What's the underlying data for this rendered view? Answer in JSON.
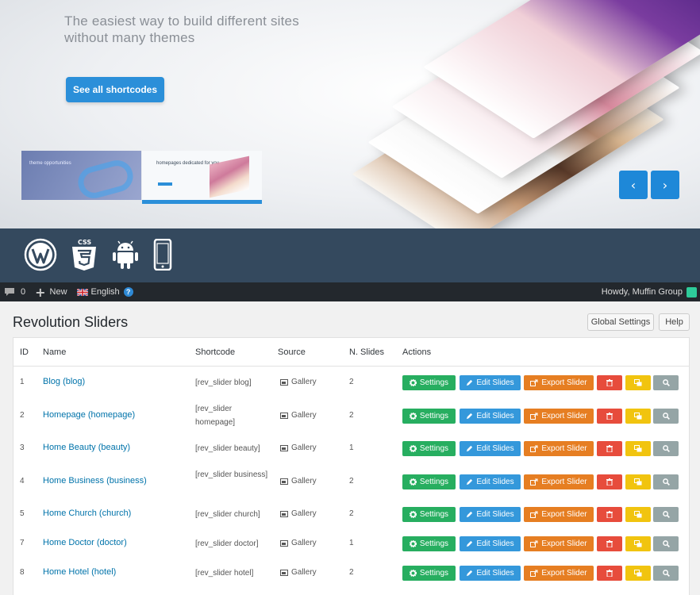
{
  "hero": {
    "tagline": "The easiest way to build different sites without many themes",
    "cta_label": "See all shortcodes",
    "thumb1_text": "theme opportunities",
    "thumb2_text": "homepages dedicated for you",
    "prev_arrow": "‹",
    "next_arrow": "›"
  },
  "tech_icons": [
    "wordpress-icon",
    "css3-icon",
    "android-icon",
    "smartphone-icon"
  ],
  "adminbar": {
    "comments_count": "0",
    "new_label": "New",
    "language_label": "English",
    "help_glyph": "?",
    "greeting": "Howdy, Muffin Group"
  },
  "page": {
    "title": "Revolution Sliders",
    "global_settings_label": "Global Settings",
    "help_label": "Help"
  },
  "table": {
    "headers": {
      "id": "ID",
      "name": "Name",
      "shortcode": "Shortcode",
      "source": "Source",
      "slides": "N. Slides",
      "actions": "Actions"
    },
    "action_labels": {
      "settings": "Settings",
      "edit": "Edit Slides",
      "export": "Export Slider"
    },
    "rows": [
      {
        "id": "1",
        "name": "Blog (blog)",
        "shortcode": "[rev_slider blog]",
        "source": "Gallery",
        "slides": "2"
      },
      {
        "id": "2",
        "name": "Homepage (homepage)",
        "shortcode": "[rev_slider homepage]",
        "source": "Gallery",
        "slides": "2"
      },
      {
        "id": "3",
        "name": "Home Beauty (beauty)",
        "shortcode": "[rev_slider beauty]",
        "source": "Gallery",
        "slides": "1"
      },
      {
        "id": "4",
        "name": "Home Business (business)",
        "shortcode": "[rev_slider business]",
        "source": "Gallery",
        "slides": "2"
      },
      {
        "id": "5",
        "name": "Home Church (church)",
        "shortcode": "[rev_slider church]",
        "source": "Gallery",
        "slides": "2"
      },
      {
        "id": "7",
        "name": "Home Doctor (doctor)",
        "shortcode": "[rev_slider doctor]",
        "source": "Gallery",
        "slides": "1"
      },
      {
        "id": "8",
        "name": "Home Hotel (hotel)",
        "shortcode": "[rev_slider hotel]",
        "source": "Gallery",
        "slides": "2"
      }
    ]
  },
  "colors": {
    "accent": "#2b8fd9",
    "band": "#34495e",
    "adminbar": "#23282d",
    "settings": "#27ae60",
    "edit": "#3498db",
    "export": "#e67e22",
    "delete": "#e74c3c",
    "duplicate": "#f1c40f",
    "preview": "#95a5a6"
  }
}
